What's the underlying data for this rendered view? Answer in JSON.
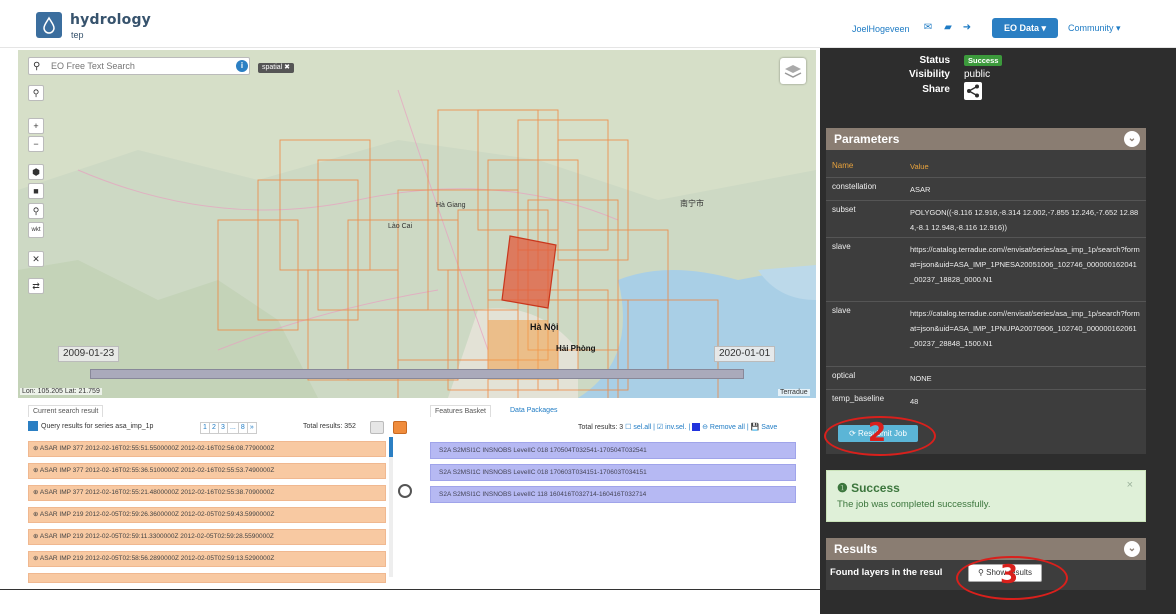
{
  "header": {
    "brand_title": "hydrology",
    "brand_sub": "tep",
    "user": "JoelHogeveen",
    "eo_data": "EO Data ▾",
    "community": "Community ▾"
  },
  "map": {
    "search_placeholder": "EO Free Text Search",
    "spatial_tag": "spatial ✖",
    "date_start": "2009-01-23",
    "date_end": "2020-01-01",
    "coords": "Lon: 105.205 Lat: 21.759",
    "attribution": "Terradue",
    "tools": [
      "+",
      "−",
      "⬢",
      "■",
      "⚲",
      "wkt",
      "✕",
      "⇄"
    ],
    "place_labels": [
      "Hà Giang",
      "Lào Cai",
      "南宁市",
      "Hà Nội",
      "Hải Phòng"
    ]
  },
  "results_panel": {
    "tab_current": "Current search result",
    "query_label": "Query results for series asa_imp_1p",
    "pager": [
      "1",
      "2",
      "3",
      "...",
      "8",
      "»"
    ],
    "total": "Total results: 352",
    "rows": [
      "ASAR IMP 377 2012-02-16T02:55:51.5500000Z 2012-02-16T02:56:08.7790000Z",
      "ASAR IMP 377 2012-02-16T02:55:36.5100000Z 2012-02-16T02:55:53.7490000Z",
      "ASAR IMP 377 2012-02-16T02:55:21.4800000Z 2012-02-16T02:55:38.7090000Z",
      "ASAR IMP 219 2012-02-05T02:59:26.3600000Z 2012-02-05T02:59:43.5990000Z",
      "ASAR IMP 219 2012-02-05T02:59:11.3300000Z 2012-02-05T02:59:28.5590000Z",
      "ASAR IMP 219 2012-02-05T02:58:56.2890000Z 2012-02-05T02:59:13.5290000Z"
    ]
  },
  "basket": {
    "tab_features": "Features Basket",
    "tab_packages": "Data Packages",
    "total": "Total results: 3",
    "actions": "☐ sel.all | ☑ inv.sel. |",
    "remove_all": "⊖ Remove all",
    "save": "| 💾 Save",
    "rows": [
      "S2A S2MSI1C INSNOBS LevelIC 018 170504T032541-170504T032541",
      "S2A S2MSI1C INSNOBS LevelIC 018 170603T034151-170603T034151",
      "S2A S2MSI1C INSNOBS LevelIC 118 160416T032714-160416T032714"
    ]
  },
  "job": {
    "status_label": "Status",
    "status_value": "Success",
    "visibility_label": "Visibility",
    "visibility_value": "public",
    "share_label": "Share"
  },
  "parameters": {
    "title": "Parameters",
    "col_name": "Name",
    "col_value": "Value",
    "rows": [
      {
        "name": "constellation",
        "value": "ASAR"
      },
      {
        "name": "subset",
        "value": "POLYGON((-8.116 12.916,-8.314 12.002,-7.855 12.246,-7.652 12.884,-8.1 12.948,-8.116 12.916))"
      },
      {
        "name": "slave",
        "value": "https://catalog.terradue.com//envisat/series/asa_imp_1p/search?format=json&uid=ASA_IMP_1PNESA20051006_102746_000000162041_00237_18828_0000.N1"
      },
      {
        "name": "slave",
        "value": "https://catalog.terradue.com//envisat/series/asa_imp_1p/search?format=json&uid=ASA_IMP_1PNUPA20070906_102740_000000162061_00237_28848_1500.N1"
      },
      {
        "name": "optical",
        "value": "NONE"
      },
      {
        "name": "temp_baseline",
        "value": "48"
      }
    ],
    "resubmit": "⟳ Resubmit Job"
  },
  "alert": {
    "title": "Success",
    "body": "The job was completed successfully."
  },
  "results": {
    "title": "Results",
    "found": "Found layers in the resul",
    "show_button": "Show results"
  },
  "annotations": [
    "2",
    "3"
  ]
}
